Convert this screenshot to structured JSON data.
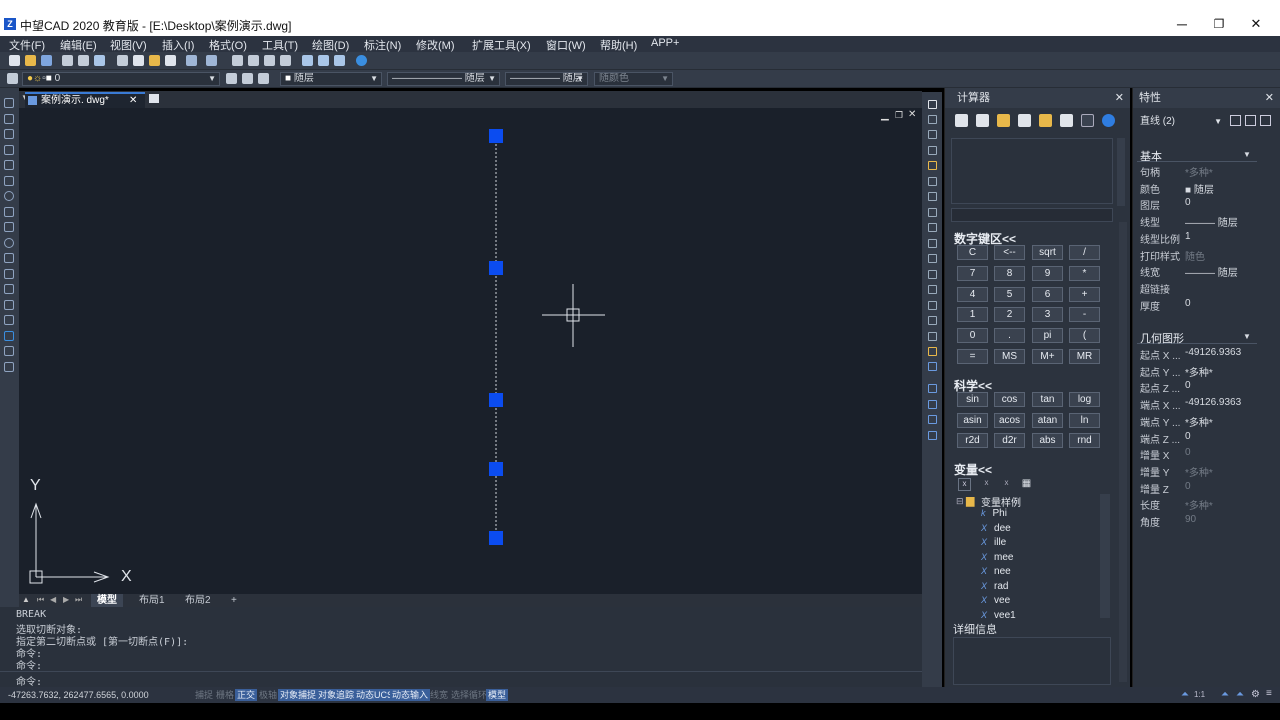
{
  "window": {
    "title": "中望CAD 2020 教育版 - [E:\\Desktop\\案例演示.dwg]",
    "app_icon": "Z",
    "minimize": "─",
    "restore": "❐",
    "close": "✕"
  },
  "menu": [
    "文件(F)",
    "编辑(E)",
    "视图(V)",
    "插入(I)",
    "格式(O)",
    "工具(T)",
    "绘图(D)",
    "标注(N)",
    "修改(M)",
    "扩展工具(X)",
    "窗口(W)",
    "帮助(H)",
    "APP+"
  ],
  "toolbar2": {
    "layer_value": "0",
    "color_value": "随层",
    "linetype_value": "随层",
    "lineweight_value": "随层",
    "plotstyle_value": "随颜色"
  },
  "document": {
    "tab_label": "案例演示. dwg*",
    "close": "✕",
    "layout_tabs": [
      "模型",
      "布局1",
      "布局2",
      "+"
    ]
  },
  "drawing": {
    "axis_x": "X",
    "axis_y": "Y"
  },
  "command": {
    "lines": [
      "BREAK",
      "选取切断对象:",
      "指定第二切断点或 [第一切断点(F)]:",
      "命令:",
      "命令:"
    ],
    "prompt": "命令:"
  },
  "status": {
    "coords": "-47263.7632, 262477.6565, 0.0000",
    "buttons": [
      {
        "label": "捕捉",
        "on": false
      },
      {
        "label": "栅格",
        "on": false
      },
      {
        "label": "正交",
        "on": true
      },
      {
        "label": "极轴",
        "on": false
      },
      {
        "label": "对象捕捉",
        "on": true
      },
      {
        "label": "对象追踪",
        "on": true
      },
      {
        "label": "动态UCS",
        "on": true
      },
      {
        "label": "动态输入",
        "on": true
      },
      {
        "label": "线宽",
        "on": false
      },
      {
        "label": "选择循环",
        "on": false
      },
      {
        "label": "模型",
        "on": true
      }
    ],
    "scale": "1:1"
  },
  "calculator": {
    "title": "计算器",
    "close": "✕",
    "numpad_title": "数字键区<<",
    "numpad_keys": [
      [
        "C",
        "<--",
        "sqrt",
        "/"
      ],
      [
        "7",
        "8",
        "9",
        "*"
      ],
      [
        "4",
        "5",
        "6",
        "+"
      ],
      [
        "1",
        "2",
        "3",
        "-"
      ],
      [
        "0",
        ".",
        "pi",
        "("
      ],
      [
        "=",
        "MS",
        "M+",
        "MR"
      ]
    ],
    "science_title": "科学<<",
    "science_keys": [
      [
        "sin",
        "cos",
        "tan",
        "log"
      ],
      [
        "asin",
        "acos",
        "atan",
        "ln"
      ],
      [
        "r2d",
        "d2r",
        "abs",
        "rnd"
      ]
    ],
    "variables_title": "变量<<",
    "var_folder": "变量样例",
    "variables": [
      {
        "icon": "k",
        "name": "Phi"
      },
      {
        "icon": "X",
        "name": "dee"
      },
      {
        "icon": "X",
        "name": "ille"
      },
      {
        "icon": "X",
        "name": "mee"
      },
      {
        "icon": "X",
        "name": "nee"
      },
      {
        "icon": "X",
        "name": "rad"
      },
      {
        "icon": "X",
        "name": "vee"
      },
      {
        "icon": "X",
        "name": "vee1"
      }
    ],
    "details_title": "详细信息"
  },
  "properties": {
    "title": "特性",
    "close": "✕",
    "selection": "直线 (2)",
    "basic_title": "基本",
    "basic": [
      {
        "label": "句柄",
        "value": "*多种*",
        "dim": true
      },
      {
        "label": "颜色",
        "value": "■ 随层",
        "dim": false
      },
      {
        "label": "图层",
        "value": "0",
        "dim": false
      },
      {
        "label": "线型",
        "value": "——— 随层",
        "dim": false
      },
      {
        "label": "线型比例",
        "value": "1",
        "dim": false
      },
      {
        "label": "打印样式",
        "value": "随色",
        "dim": true
      },
      {
        "label": "线宽",
        "value": "——— 随层",
        "dim": false
      },
      {
        "label": "超链接",
        "value": "",
        "dim": false
      },
      {
        "label": "厚度",
        "value": "0",
        "dim": false
      }
    ],
    "geometry_title": "几何图形",
    "geometry": [
      {
        "label": "起点 X ...",
        "value": "-49126.9363",
        "dim": false
      },
      {
        "label": "起点 Y ...",
        "value": "*多种*",
        "dim": false
      },
      {
        "label": "起点 Z ...",
        "value": "0",
        "dim": false
      },
      {
        "label": "端点 X ...",
        "value": "-49126.9363",
        "dim": false
      },
      {
        "label": "端点 Y ...",
        "value": "*多种*",
        "dim": false
      },
      {
        "label": "端点 Z ...",
        "value": "0",
        "dim": false
      },
      {
        "label": "增量 X",
        "value": "0",
        "dim": true
      },
      {
        "label": "增量 Y",
        "value": "*多种*",
        "dim": true
      },
      {
        "label": "增量 Z",
        "value": "0",
        "dim": true
      },
      {
        "label": "长度",
        "value": "*多种*",
        "dim": true
      },
      {
        "label": "角度",
        "value": "90",
        "dim": true
      }
    ]
  }
}
